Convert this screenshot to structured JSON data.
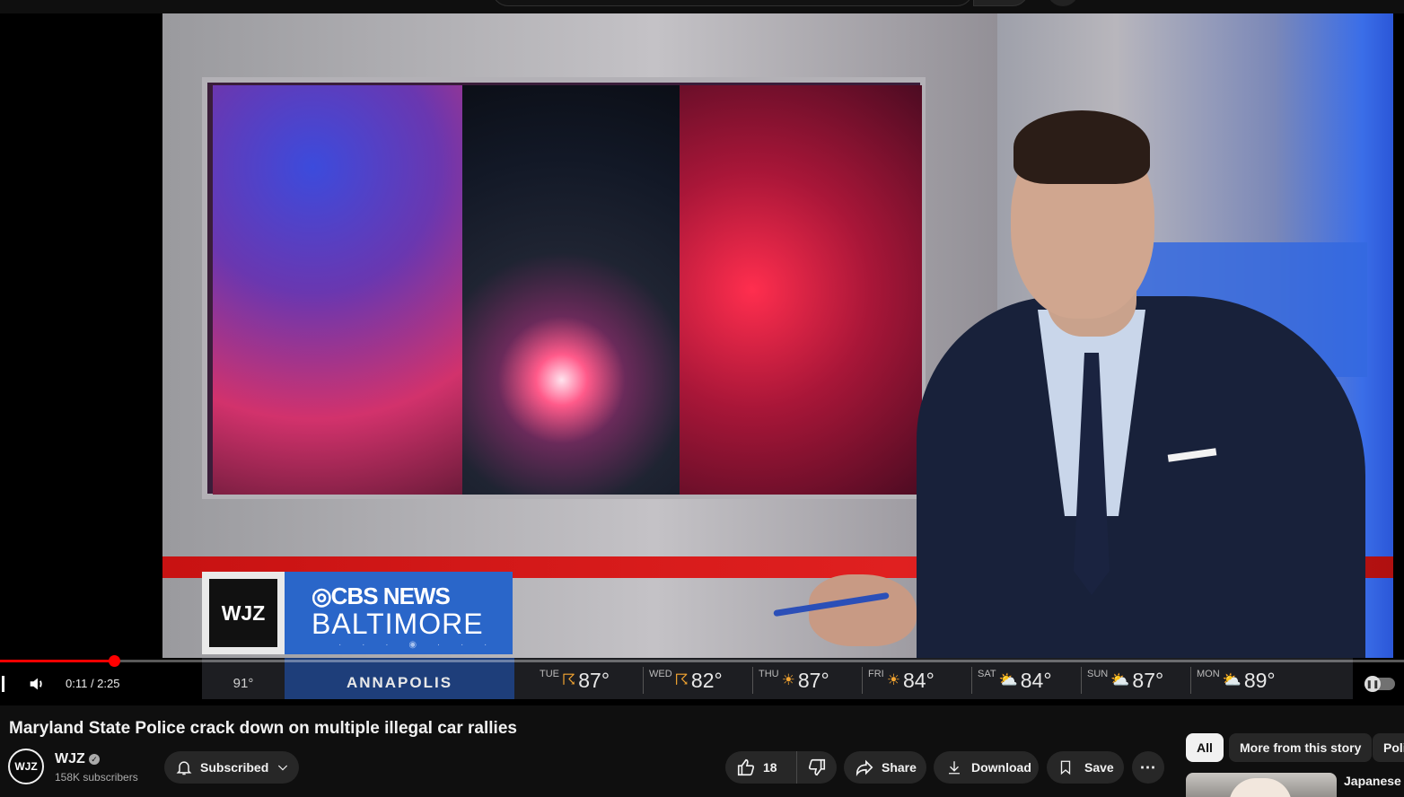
{
  "player": {
    "lower_third": {
      "logo": "WJZ",
      "brand_top": "◎CBS NEWS",
      "brand_bottom": "BALTIMORE",
      "current_temp": "91°",
      "city": "ANNAPOLIS",
      "forecast": [
        {
          "day": "TUE",
          "icon": "thunderstorm-icon",
          "glyph": "☈",
          "temp": "87°"
        },
        {
          "day": "WED",
          "icon": "thunderstorm-icon",
          "glyph": "☈",
          "temp": "82°"
        },
        {
          "day": "THU",
          "icon": "sun-icon",
          "glyph": "☀",
          "temp": "87°"
        },
        {
          "day": "FRI",
          "icon": "sun-icon",
          "glyph": "☀",
          "temp": "84°"
        },
        {
          "day": "SAT",
          "icon": "partly-cloudy-icon",
          "glyph": "⛅",
          "temp": "84°"
        },
        {
          "day": "SUN",
          "icon": "partly-cloudy-icon",
          "glyph": "⛅",
          "temp": "87°"
        },
        {
          "day": "MON",
          "icon": "partly-cloudy-icon",
          "glyph": "⛅",
          "temp": "89°"
        }
      ]
    },
    "progress_fraction": 0.0815,
    "time": "0:11 / 2:25",
    "accent_color": "#ff0000"
  },
  "video": {
    "title": "Maryland State Police crack down on multiple illegal car rallies"
  },
  "channel": {
    "avatar_text": "WJZ",
    "name": "WJZ",
    "subscribers": "158K subscribers",
    "subscribe_label": "Subscribed"
  },
  "actions": {
    "likes": "18",
    "share": "Share",
    "download": "Download",
    "save": "Save"
  },
  "chips": {
    "all": "All",
    "more_story": "More from this story",
    "poli": "Poli"
  },
  "recommendation": {
    "title": "Japanese A"
  }
}
